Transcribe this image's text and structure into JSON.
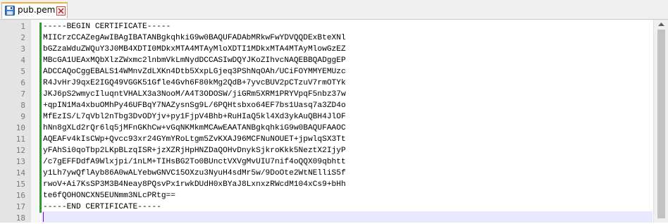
{
  "tab": {
    "title": "pub.pem",
    "icon": "save-disk-icon",
    "close_icon": "close-icon"
  },
  "colors": {
    "tab_accent": "#f7b23b",
    "change_bar": "#2f9a2f",
    "current_line": "#e8e8ff",
    "caret": "#8000ff",
    "close_border": "#d04040"
  },
  "editor": {
    "line_numbers": [
      "1",
      "2",
      "3",
      "4",
      "5",
      "6",
      "7",
      "8",
      "9",
      "10",
      "11",
      "12",
      "13",
      "14",
      "15",
      "16",
      "17",
      "18"
    ],
    "lines": [
      "-----BEGIN CERTIFICATE-----",
      "MIICrzCCAZegAwIBAgIBATANBgkqhkiG9w0BAQUFADAbMRkwFwYDVQQDExBteXNl",
      "bGZzaWduZWQuY3J0MB4XDTI0MDkxMTA4MTAyMloXDTI1MDkxMTA4MTAyMlowGzEZ",
      "MBcGA1UEAxMQbXlzZWxmc2lnbmVkLmNydDCCASIwDQYJKoZIhvcNAQEBBQADggEP",
      "ADCCAQoCggEBALS14WMnvZdLXKn4Dtb5XxpLGjeq3PShNqOAh/UCiFOYMMYEMUzc",
      "R4JvHrJ9qxE2IGQ49VGGK51Gfle4Gvh6F80kMg2QdB+7yvcBUV2pCTzuV7rmOTYk",
      "JKJ6pS2wmycIluqntVHALX3a3NooM/A4T3ODOSW/jiGRm5XRM1PRYVpqF5nbz37w",
      "+qpIN1Ma4xbuOMhPy46UFBqY7NAZysnSg9L/6PQHtsbxo64EF7bs1Uasq7a3ZD4o",
      "MfEzIS/L7qVbl2nTbg3DvODYjv+py1FjpV4Bhb+RuHIaQ5kl4Xd3ykAuQBH4JlOF",
      "hNn8gXLd2rQr6lq5jMFnGKhCw+vGqNKMkmMCAwEAATANBgkqhkiG9w0BAQUFAAOC",
      "AQEAFv4kIsCWp+Qvcc93xr24GYmYRoLtgm5ZvKXAJ96MCFNuNOUET+jpwlqSX3Tt",
      "yFAhSi0qoTbp2LKpBLzqISR+jzXZRjHpHNZDaQOHvDnykSjkroKkk5NeztX2IjyP",
      "/c7gEFFDdfA9Wlxjpi/1nLM+TIHsBG2To0BUnctVXVgMvUIU7nif4oQQX09qbhtt",
      "y1Lh7ywQflAyb86A0wALYebwGNVC15OXzu3NyuH4sdMr5w/9DoOte2WtNElliS5f",
      "rwoV+Ai7KsSP3M3B4Neay8PQsvPx1rwkDUdH0xBYaJ8LxnxzRWcdM104xCs9+bHh",
      "te6fQOHONCXN5EUNmm3NLcPRtg==",
      "-----END CERTIFICATE-----",
      ""
    ]
  }
}
